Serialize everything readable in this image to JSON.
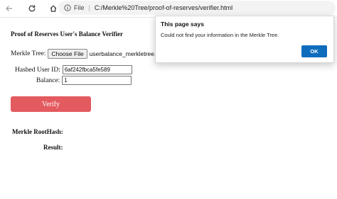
{
  "browser": {
    "file_label": "File",
    "url": "C:/Merkle%20Tree/proof-of-reserves/verifier.html"
  },
  "page": {
    "title": "Proof of Reserves User's Balance Verifier",
    "merkle_tree_label": "Merkle Tree:",
    "choose_file_label": "Choose File",
    "selected_file": "userbalance_merkletree.txt",
    "hashed_user_id_label": "Hashed User ID:",
    "hashed_user_id_value": "6af242fbca5fe589",
    "balance_label": "Balance:",
    "balance_value": "1",
    "verify_button": "Verify",
    "root_hash_label": "Merkle RootHash:",
    "result_label": "Result:"
  },
  "dialog": {
    "title": "This page says",
    "message": "Could not find your information in the Merkle Tree.",
    "ok_button": "OK"
  },
  "colors": {
    "verify_button": "#e35a5f",
    "ok_button": "#0f6cbd"
  }
}
